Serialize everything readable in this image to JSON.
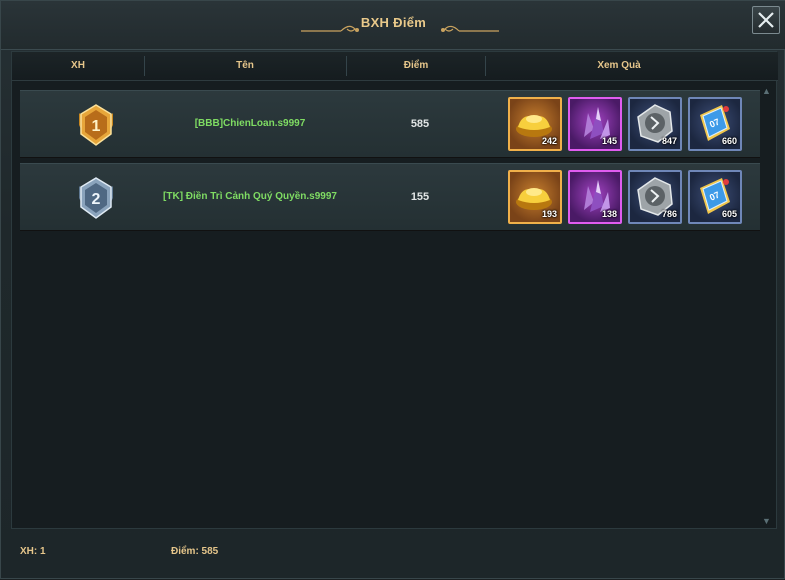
{
  "window": {
    "title": "BXH Điểm"
  },
  "table": {
    "headers": {
      "rank": "XH",
      "name": "Tên",
      "score": "Điểm",
      "rewards": "Xem Quà"
    },
    "rows": [
      {
        "rank": 1,
        "rank_icon": "gold-rank-1-badge-icon",
        "name": "[BBB]ChienLoan.s9997",
        "score": "585",
        "rewards": [
          {
            "icon": "gold-ingot-icon",
            "qty": "242"
          },
          {
            "icon": "purple-crystal-icon",
            "qty": "145"
          },
          {
            "icon": "silver-rune-stone-icon",
            "qty": "847"
          },
          {
            "icon": "blue-scroll-token-icon",
            "qty": "660"
          }
        ]
      },
      {
        "rank": 2,
        "rank_icon": "silver-rank-2-badge-icon",
        "name": "[TK] Điền Trì Cảnh Quý Quyền.s9997",
        "score": "155",
        "rewards": [
          {
            "icon": "gold-ingot-icon",
            "qty": "193"
          },
          {
            "icon": "purple-crystal-icon",
            "qty": "138"
          },
          {
            "icon": "silver-rune-stone-icon",
            "qty": "786"
          },
          {
            "icon": "blue-scroll-token-icon",
            "qty": "605"
          }
        ]
      }
    ]
  },
  "footer": {
    "rank_text": "XH: 1",
    "score_text": "Điểm: 585"
  },
  "colors": {
    "accent_gold": "#e6c68b",
    "name_green": "#7fdc63",
    "gold_border": "#f0b04a",
    "purple_border": "#e05cf0",
    "blue_border": "#6f87b8"
  }
}
